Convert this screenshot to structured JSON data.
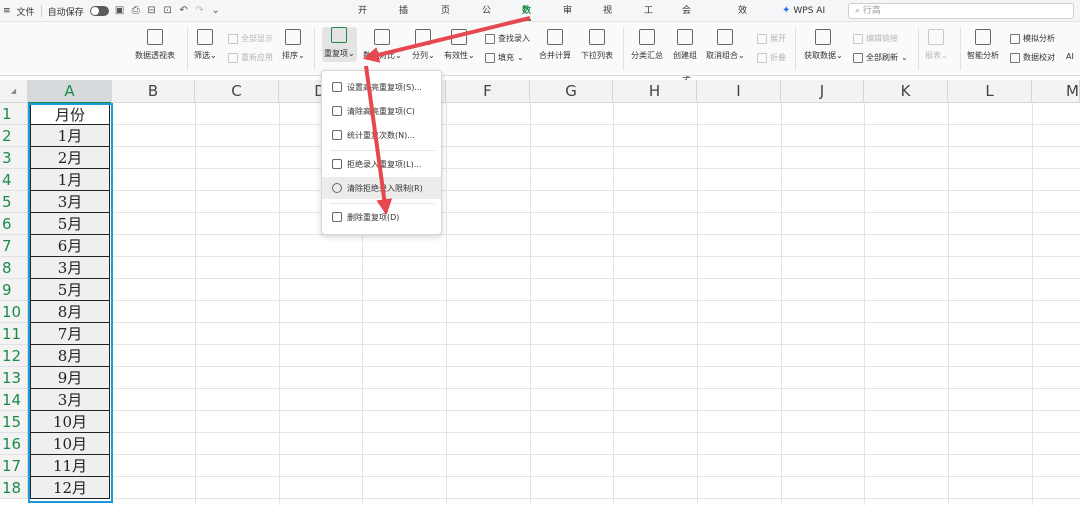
{
  "menubar": {
    "menu_icon": "≡",
    "file": "文件",
    "autosave": "自动保存",
    "tabs": [
      "开始",
      "插入",
      "页面",
      "公式",
      "数据",
      "审阅",
      "视图",
      "工具",
      "会员专享",
      "效率"
    ],
    "active_tab": "数据",
    "wps_ai": "WPS AI",
    "search_placeholder": "行高"
  },
  "ribbon": {
    "pivot": "数据透视表",
    "filter": "筛选",
    "show_all": "全部显示",
    "reapply": "重新应用",
    "sort": "排序",
    "duplicates": "重复项",
    "compare": "数据对比",
    "split": "分列",
    "validity": "有效性",
    "lookup_entry": "查找录入",
    "fill": "填充",
    "consolidate": "合并计算",
    "dropdown_list": "下拉列表",
    "subtotal": "分类汇总",
    "group": "创建组",
    "ungroup": "取消组合",
    "expand": "展开",
    "collapse": "折叠",
    "get_data": "获取数据",
    "edit_links": "编辑链接",
    "refresh_all": "全部刷新",
    "report": "报表",
    "smart_analysis": "智能分析",
    "what_if": "模拟分析",
    "check": "数据校对",
    "ai": "AI"
  },
  "dropdown": {
    "items": [
      "设置高亮重复项(S)...",
      "清除高亮重复项(C)",
      "统计重复次数(N)...",
      "拒绝录入重复项(L)...",
      "清除拒绝录入限制(R)",
      "删除重复项(D)"
    ]
  },
  "sheet": {
    "columns": [
      "A",
      "B",
      "C",
      "D",
      "E",
      "F",
      "G",
      "H",
      "I",
      "J",
      "K",
      "L",
      "M"
    ],
    "rows": [
      "1",
      "2",
      "3",
      "4",
      "5",
      "6",
      "7",
      "8",
      "9",
      "10",
      "11",
      "12",
      "13",
      "14",
      "15",
      "16",
      "17",
      "18"
    ],
    "colA": [
      "月份",
      "1月",
      "2月",
      "1月",
      "3月",
      "5月",
      "6月",
      "3月",
      "5月",
      "8月",
      "7月",
      "8月",
      "9月",
      "3月",
      "10月",
      "10月",
      "11月",
      "12月"
    ]
  },
  "colors": {
    "accent": "#1e8a4a",
    "selection": "#1a9ad6",
    "arrow": "#e5484d"
  }
}
